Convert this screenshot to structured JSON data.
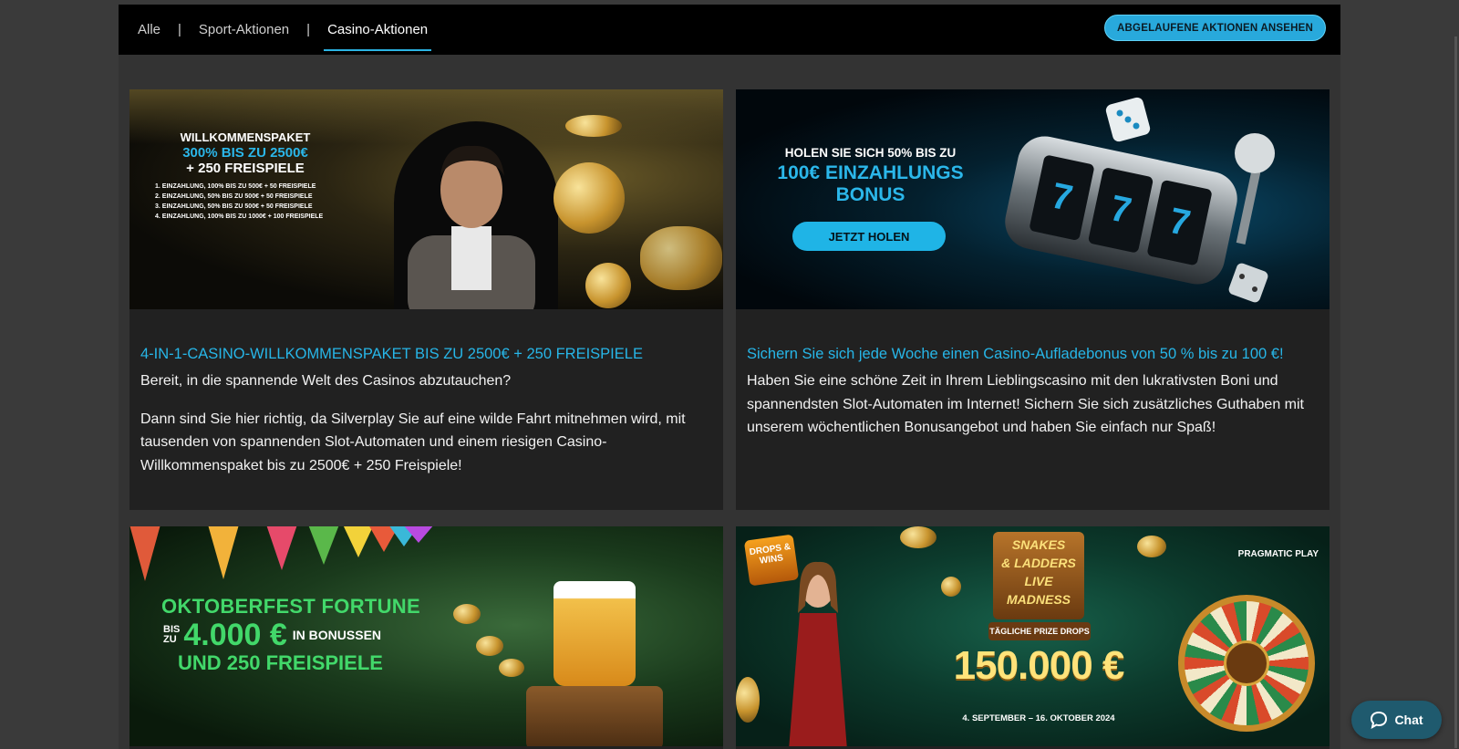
{
  "nav": {
    "tabs": [
      {
        "label": "Alle",
        "active": false
      },
      {
        "label": "Sport-Aktionen",
        "active": false
      },
      {
        "label": "Casino-Aktionen",
        "active": true
      }
    ],
    "separator": "|",
    "expired_button": "ABGELAUFENE AKTIONEN ANSEHEN"
  },
  "cards": [
    {
      "banner": {
        "line1": "WILLKOMMENSPAKET",
        "line2": "300% BIS ZU 2500€",
        "line3": "+ 250 FREISPIELE",
        "details": [
          "1. EINZAHLUNG, 100% BIS ZU 500€ + 50 FREISPIELE",
          "2. EINZAHLUNG, 50% BIS ZU 500€ + 50 FREISPIELE",
          "3. EINZAHLUNG, 50% BIS ZU 500€ + 50 FREISPIELE",
          "4. EINZAHLUNG, 100% BIS ZU 1000€ + 100 FREISPIELE"
        ]
      },
      "title": "4-IN-1-CASINO-WILLKOMMENSPAKET BIS ZU 2500€ + 250 FREISPIELE",
      "paragraphs": [
        "Bereit, in die spannende Welt des Casinos abzutauchen?",
        "Dann sind Sie hier richtig, da Silverplay Sie auf eine wilde Fahrt mitnehmen wird, mit tausenden von spannenden Slot-Automaten und einem riesigen Casino-Willkommenspaket bis zu 2500€ + 250 Freispiele!"
      ]
    },
    {
      "banner": {
        "line1": "HOLEN SIE SICH 50% BIS ZU",
        "line2": "100€ EINZAHLUNGS BONUS",
        "button": "JETZT HOLEN",
        "reels": [
          "7",
          "7",
          "7"
        ]
      },
      "title": "Sichern Sie sich jede Woche einen Casino-Aufladebonus von 50 % bis zu 100 €!",
      "paragraphs": [
        "Haben Sie eine schöne Zeit in Ihrem Lieblingscasino mit den lukrativsten Boni und spannendsten Slot-Automaten im Internet! Sichern Sie sich zusätzliches Guthaben mit unserem wöchentlichen Bonusangebot und haben Sie einfach nur Spaß!"
      ]
    },
    {
      "banner": {
        "line1": "OKTOBERFEST FORTUNE",
        "bis": "BIS",
        "zu": "ZU",
        "amount": "4.000 €",
        "bonus": "IN BONUSSEN",
        "line3": "UND 250 FREISPIELE"
      }
    },
    {
      "banner": {
        "drops": "DROPS & WINS",
        "logo_lines": [
          "SNAKES",
          "& LADDERS",
          "LIVE",
          "MADNESS"
        ],
        "prize_drops": "TÄGLICHE PRIZE DROPS",
        "amount": "150.000 €",
        "dates": "4. SEPTEMBER – 16. OKTOBER 2024",
        "provider": "PRAGMATIC PLAY"
      }
    }
  ],
  "chat": {
    "label": "Chat"
  },
  "colors": {
    "accent": "#2bb7ea",
    "card_bg": "#212121",
    "page_bg": "#333333",
    "nav_bg": "#000000"
  }
}
